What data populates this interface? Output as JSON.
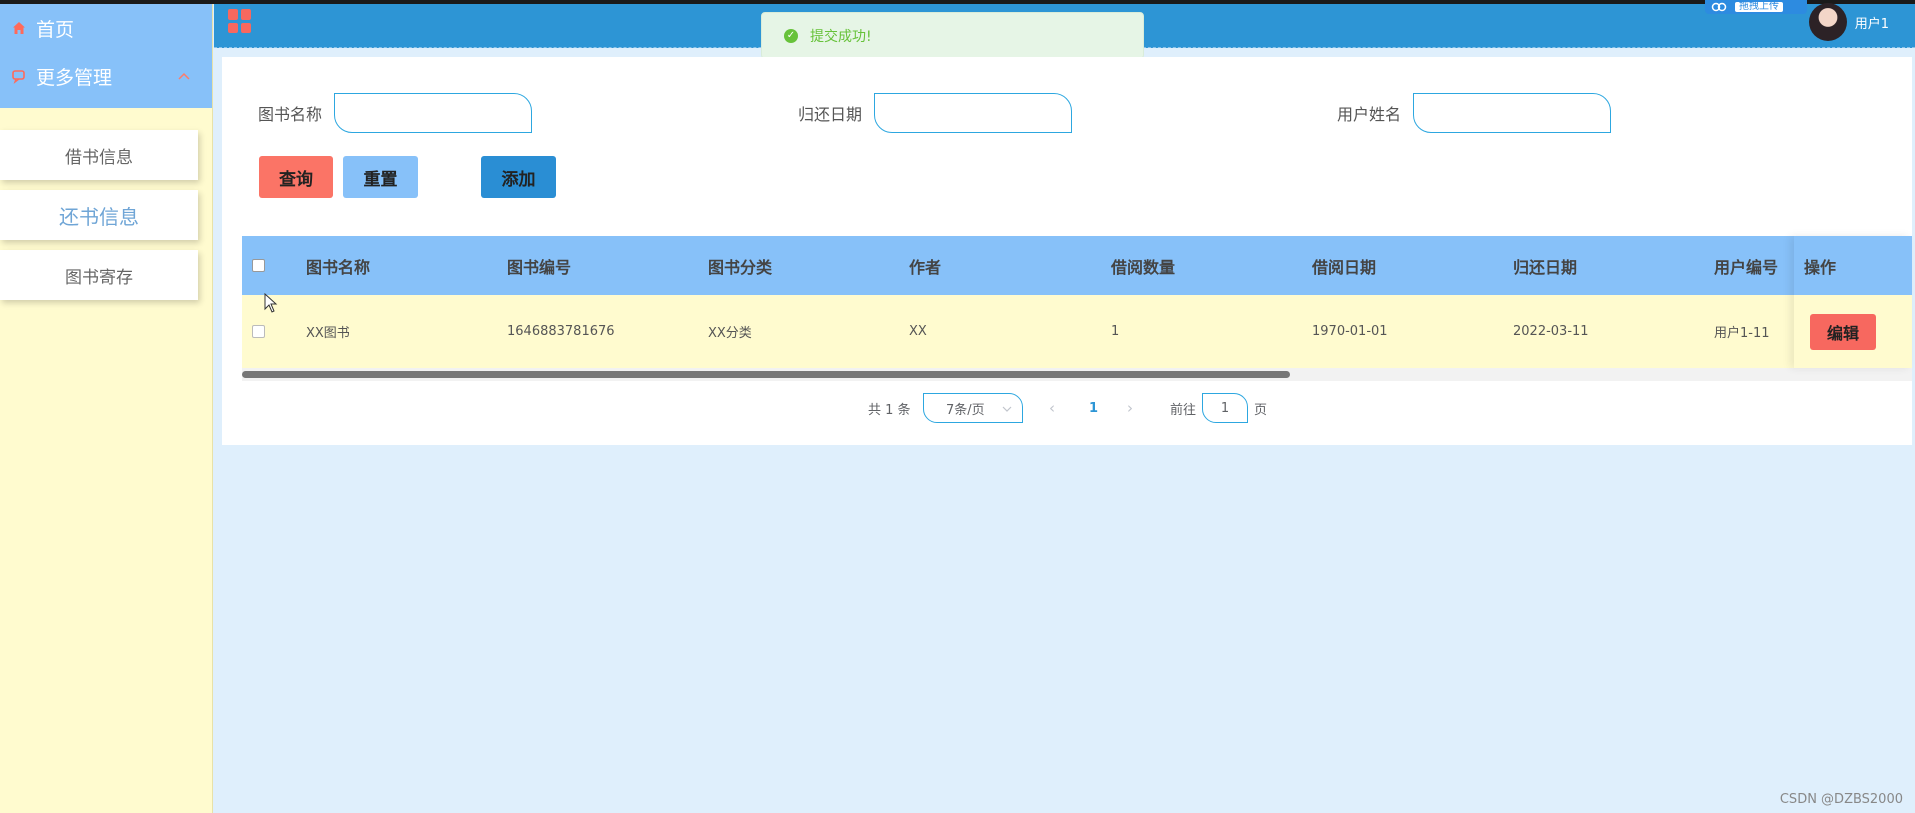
{
  "sidebar": {
    "items": [
      {
        "label": "首页",
        "icon": "home-icon"
      },
      {
        "label": "更多管理",
        "icon": "chat-icon"
      }
    ],
    "sub_items": [
      {
        "label": "借书信息"
      },
      {
        "label": "还书信息"
      },
      {
        "label": "图书寄存"
      }
    ]
  },
  "header": {
    "user_name": "用户1",
    "upload_label": "拖拽上传"
  },
  "toast": {
    "message": "提交成功!"
  },
  "search": {
    "book_name_label": "图书名称",
    "return_date_label": "归还日期",
    "user_name_label": "用户姓名",
    "book_name_value": "",
    "return_date_value": "",
    "user_name_value": ""
  },
  "buttons": {
    "query": "查询",
    "reset": "重置",
    "add": "添加",
    "edit": "编辑"
  },
  "table": {
    "columns": [
      "图书名称",
      "图书编号",
      "图书分类",
      "作者",
      "借阅数量",
      "借阅日期",
      "归还日期",
      "用户编号",
      "操作"
    ],
    "rows": [
      {
        "book_name": "XX图书",
        "book_no": "1646883781676",
        "category": "XX分类",
        "author": "XX",
        "quantity": "1",
        "borrow_date": "1970-01-01",
        "return_date": "2022-03-11",
        "user_no": "用户1-11"
      }
    ]
  },
  "pagination": {
    "total": "共 1 条",
    "page_size": "7条/页",
    "current_page": "1",
    "goto_label": "前往",
    "goto_value": "1",
    "page_suffix": "页"
  },
  "watermark": "CSDN @DZBS2000",
  "colors": {
    "sidebar_bg": "#fffbcf",
    "menu_blue": "#87c1f9",
    "header_blue": "#2d95d5",
    "query_red": "#fb7466",
    "add_blue": "#2a8ed4",
    "page_bg": "#dfeffc"
  }
}
